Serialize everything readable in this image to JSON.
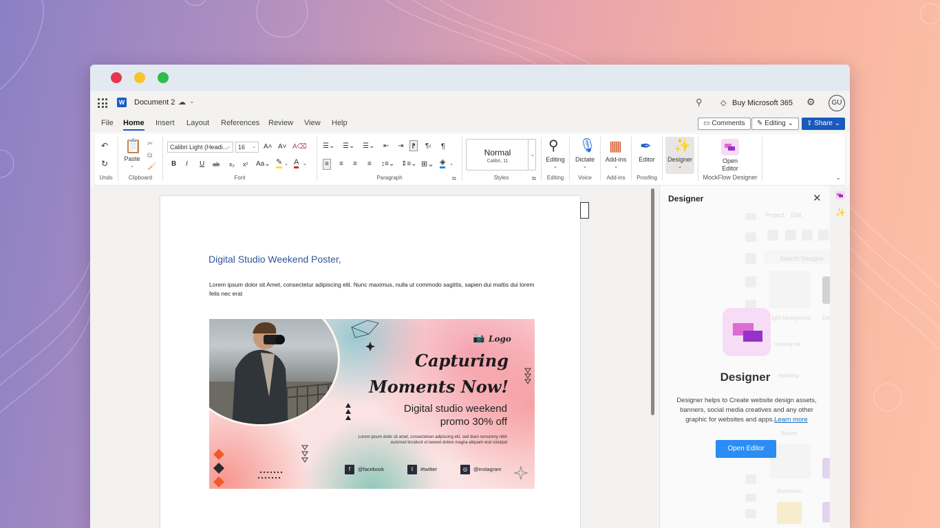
{
  "app": {
    "document_title": "Document 2",
    "buy_label": "Buy Microsoft 365",
    "avatar_initials": "GU"
  },
  "tabs": [
    "File",
    "Home",
    "Insert",
    "Layout",
    "References",
    "Review",
    "View",
    "Help"
  ],
  "actions": {
    "comments": "Comments",
    "editing": "Editing",
    "share": "Share"
  },
  "ribbon": {
    "undo_group": "Undo",
    "paste": "Paste",
    "clipboard_group": "Clipboard",
    "font_name": "Calibri Light (Headi...",
    "font_size": "16",
    "font_group": "Font",
    "paragraph_group": "Paragraph",
    "style_name": "Normal",
    "style_font": "Calibri, 11",
    "styles_group": "Styles",
    "editing_btn": "Editing",
    "editing_group": "Editing",
    "dictate_btn": "Dictate",
    "voice_group": "Voice",
    "addins_btn": "Add-ins",
    "addins_group": "Add-ins",
    "editor_btn": "Editor",
    "proofing_group": "Proofing",
    "designer_btn": "Designer",
    "open_editor_line1": "Open",
    "open_editor_line2": "Editor",
    "mockflow_group": "MockFlow Designer"
  },
  "document": {
    "heading": "Digital Studio Weekend Poster,",
    "body": "Lorem ipsum dolor sit Amet, consectetur adipiscing elit. Nunc maximus, nulla ut commodo sagittis, sapien dui mattis dui lorem felis nec erat"
  },
  "poster": {
    "logo": "Logo",
    "title_line1": "Capturing",
    "title_line2": "Moments Now!",
    "subtitle_line1": "Digital studio weekend",
    "subtitle_line2": "promo 30% off",
    "blurb": "Lorem ipsum dolor sit amet, consectetuer adipiscing elit, sed diam nonummy nibh euismod tincidunt ut laoreet dolore magna aliquam erat volutpat",
    "facebook": "@facebook",
    "twitter": "#twitter",
    "instagram": "@instagram"
  },
  "designer_pane": {
    "title": "Designer",
    "app_name": "Designer",
    "description": "Designer helps to Create website design assets, banners, social media creatives and any other graphic for websites and apps.",
    "learn_more": "Learn more",
    "open_editor": "Open Editor",
    "bg_tab_project": "Project",
    "bg_tab_edit": "Edit",
    "bg_search": "Search Designs",
    "bg_light_background": "Light background",
    "bg_dark": "Dark",
    "bg_heading_title": "Heading title",
    "bg_heading": "Heading",
    "bg_button": "Button",
    "bg_illustration": "Illustration"
  },
  "colors": {
    "word_blue": "#185abd",
    "heading_blue": "#2f5496",
    "designer_button": "#2b8cf3",
    "designer_pink": "#dc6bd2",
    "designer_purple": "#9432c9"
  }
}
